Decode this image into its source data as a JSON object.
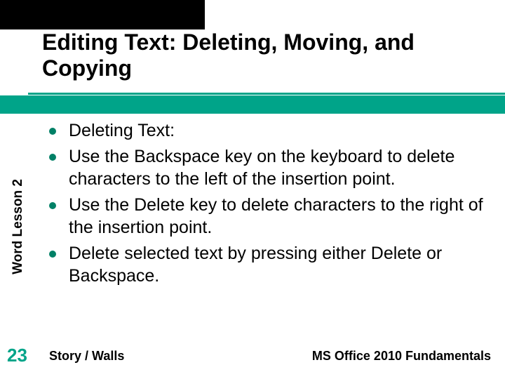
{
  "title": "Editing Text: Deleting, Moving, and Copying",
  "side_label": "Word Lesson 2",
  "bullets": [
    "Deleting Text:",
    "Use the Backspace key on the keyboard to delete characters to the left of the insertion point.",
    "Use the Delete key to delete characters to the right of the insertion point.",
    "Delete selected text by pressing either Delete or Backspace."
  ],
  "page_number": "23",
  "footer_left": "Story / Walls",
  "footer_right": "MS Office 2010 Fundamentals"
}
